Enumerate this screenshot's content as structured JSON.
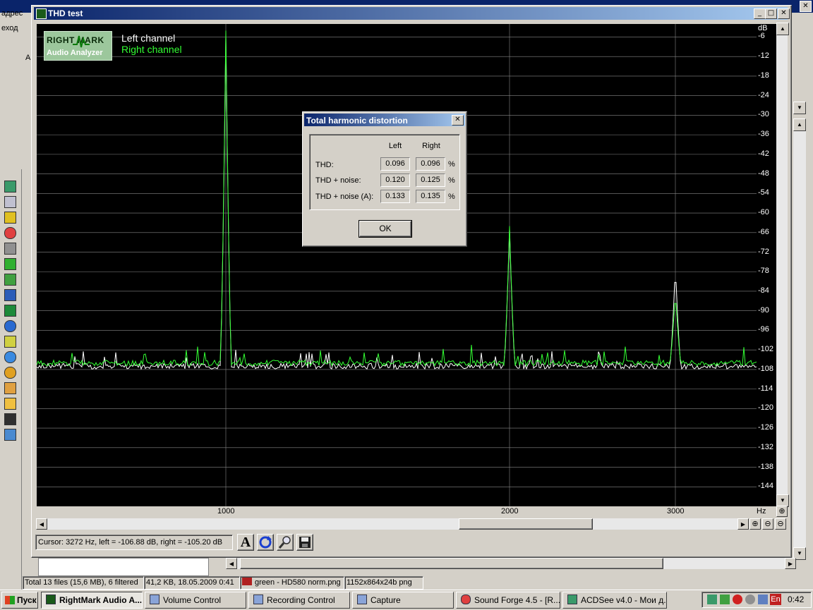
{
  "window": {
    "title": "THD test",
    "minimize": "_",
    "maximize": "□",
    "close": "✕"
  },
  "logo": {
    "line1": "RIGHT MARK",
    "line2": "Audio Analyzer"
  },
  "legend": {
    "left": "Left channel",
    "right": "Right channel"
  },
  "colors": {
    "left_channel": "#ffffff",
    "right_channel": "#33ff33",
    "plot_bg": "#000000",
    "grid": "#888888",
    "titlebar": "#0a246a"
  },
  "chart_data": {
    "type": "line",
    "xlabel": "Hz",
    "ylabel": "dB",
    "x_ticks": [
      "1000",
      "2000",
      "3000"
    ],
    "y_ticks": [
      "-6",
      "-12",
      "-18",
      "-24",
      "-30",
      "-36",
      "-42",
      "-48",
      "-54",
      "-60",
      "-66",
      "-72",
      "-78",
      "-84",
      "-90",
      "-96",
      "-102",
      "-108",
      "-114",
      "-120",
      "-126",
      "-132",
      "-138",
      "-144"
    ],
    "ylim": [
      -150,
      -2
    ],
    "series": [
      {
        "name": "Left channel",
        "color": "#ffffff",
        "noise_floor_db": -107,
        "peaks": [
          {
            "hz": 1000,
            "db": -5.5
          },
          {
            "hz": 2000,
            "db": -65
          },
          {
            "hz": 3000,
            "db": -76
          }
        ]
      },
      {
        "name": "Right channel",
        "color": "#33ff33",
        "noise_floor_db": -106,
        "peaks": [
          {
            "hz": 1000,
            "db": -4
          },
          {
            "hz": 2000,
            "db": -64
          },
          {
            "hz": 3000,
            "db": -84
          }
        ]
      }
    ]
  },
  "dialog": {
    "title": "Total harmonic distortion",
    "col_left": "Left",
    "col_right": "Right",
    "rows": [
      {
        "label": "THD:",
        "left": "0.096",
        "right": "0.096",
        "unit": "%"
      },
      {
        "label": "THD + noise:",
        "left": "0.120",
        "right": "0.125",
        "unit": "%"
      },
      {
        "label": "THD + noise (A):",
        "left": "0.133",
        "right": "0.135",
        "unit": "%"
      }
    ],
    "ok": "OK"
  },
  "cursor_status": "Cursor:  3272 Hz,  left = -106.88 dB,  right = -105.20 dB",
  "tools": {
    "text_tool": "A"
  },
  "bg_left_labels": [
    "адрес",
    "еход",
    "А"
  ],
  "explorer_status": [
    "Total 13 files (15,6 MB), 6 filtered",
    "41,2 KB, 18.05.2009 0:41",
    "green - HD580 norm.png",
    "1152x864x24b png"
  ],
  "taskbar": {
    "start": "Пуск",
    "buttons": [
      "RightMark Audio A...",
      "Volume Control",
      "Recording Control",
      "Capture",
      "Sound Forge 4.5 - [R...",
      "ACDSee v4.0 - Мои д..."
    ],
    "lang": "En",
    "clock": "0:42"
  }
}
